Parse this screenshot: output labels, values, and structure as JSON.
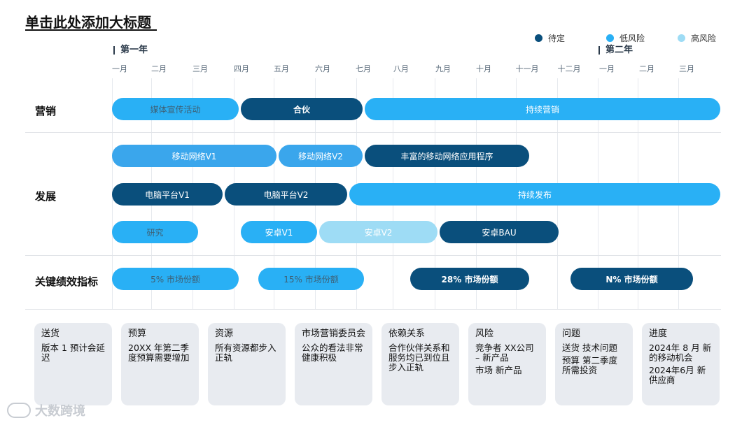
{
  "title": "单击此处添加大标题",
  "legend": [
    {
      "label": "待定",
      "color": "#0a4f7c"
    },
    {
      "label": "低风险",
      "color": "#29b0f5"
    },
    {
      "label": "高风险",
      "color": "#9edcf5"
    }
  ],
  "years": {
    "y1": "第一年",
    "y2": "第二年"
  },
  "months": [
    "一月",
    "二月",
    "三月",
    "四月",
    "五月",
    "六月",
    "七月",
    "八月",
    "九月",
    "十月",
    "十一月",
    "十二月",
    "一月",
    "二月",
    "三月"
  ],
  "sections": {
    "marketing": "营销",
    "development": "发展",
    "kpi": "关键绩效指标"
  },
  "bars": {
    "media": "媒体宣传活动",
    "partner": "合伙",
    "cont_marketing": "持续营销",
    "mobile_v1": "移动网络V1",
    "mobile_v2": "移动网络V2",
    "rich_mobile": "丰富的移动网络应用程序",
    "pc_v1": "电脑平台V1",
    "pc_v2": "电脑平台V2",
    "cont_release": "持续发布",
    "research": "研究",
    "android_v1": "安卓V1",
    "android_v2": "安卓V2",
    "android_bau": "安卓BAU",
    "kpi1": "5% 市场份额",
    "kpi2": "15% 市场份额",
    "kpi3": "28% 市场份额",
    "kpi4": "N% 市场份额"
  },
  "cards": [
    {
      "heading": "送货",
      "lines": [
        "版本 1 预计会延迟"
      ]
    },
    {
      "heading": "预算",
      "lines": [
        "20XX 年第二季度预算需要增加"
      ]
    },
    {
      "heading": "资源",
      "lines": [
        "所有资源都步入正轨"
      ]
    },
    {
      "heading": "市场营销委员会",
      "lines": [
        "公众的看法非常健康积极"
      ]
    },
    {
      "heading": "依赖关系",
      "lines": [
        "合作伙伴关系和服务均已到位且步入正轨"
      ]
    },
    {
      "heading": "风险",
      "lines": [
        "竞争者 XX公司 – 新产品",
        "市场 新产品"
      ]
    },
    {
      "heading": "问题",
      "lines": [
        "送货 技术问题",
        "预算 第二季度所需投资"
      ]
    },
    {
      "heading": "进度",
      "lines": [
        "2024年 8 月 新的移动机会",
        "2024年6月 新供应商"
      ]
    }
  ],
  "watermark": "大数跨境"
}
